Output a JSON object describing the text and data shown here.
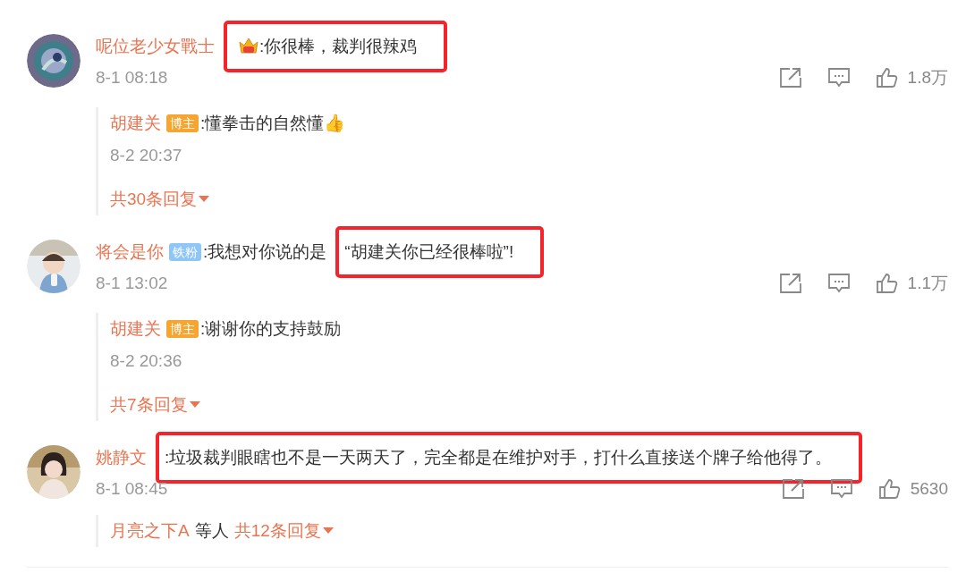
{
  "comments": [
    {
      "author": "呢位老少女戰士",
      "vip": true,
      "segments": [
        {
          "text": ":你很棒，裁判很辣鸡",
          "highlighted": true
        }
      ],
      "time": "8-1 08:18",
      "likes": "1.8万",
      "replies": [
        {
          "author": "胡建关",
          "badge": {
            "label": "博主",
            "kind": "owner"
          },
          "text": ":懂拳击的自然懂👍",
          "time": "8-2 20:37"
        }
      ],
      "reply_summary": {
        "count": "共30条回复"
      }
    },
    {
      "author": "将会是你",
      "badge": {
        "label": "铁粉",
        "kind": "fan"
      },
      "segments": [
        {
          "text": ":我想对你说的是",
          "highlighted": false
        },
        {
          "text": "“胡建关你已经很棒啦”!",
          "highlighted": true
        }
      ],
      "time": "8-1 13:02",
      "likes": "1.1万",
      "replies": [
        {
          "author": "胡建关",
          "badge": {
            "label": "博主",
            "kind": "owner"
          },
          "text": ":谢谢你的支持鼓励",
          "time": "8-2 20:36"
        }
      ],
      "reply_summary": {
        "count": "共7条回复"
      }
    },
    {
      "author": "姚静文",
      "segments": [
        {
          "text": ":垃圾裁判眼瞎也不是一天两天了，完全都是在维护对手，打什么直接送个牌子给他得了。",
          "highlighted": true
        }
      ],
      "time": "8-1 08:45",
      "likes": "5630",
      "reply_summary": {
        "users": "月亮之下A",
        "joiner": "等人",
        "count": "共12条回复"
      }
    }
  ]
}
